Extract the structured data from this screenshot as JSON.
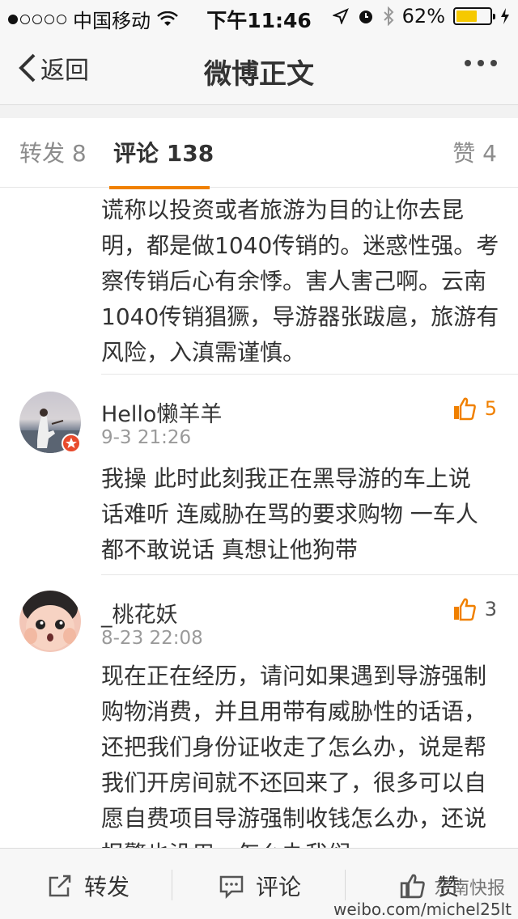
{
  "status_bar": {
    "carrier": "中国移动",
    "time": "下午11:46",
    "battery": "62%",
    "battery_level": 0.62
  },
  "nav": {
    "back_label": "返回",
    "title": "微博正文"
  },
  "tabs": {
    "repost": "转发 8",
    "comment": "评论 138",
    "like": "赞 4"
  },
  "comments": [
    {
      "text": "谎称以投资或者旅游为目的让你去昆明，都是做1040传销的。迷惑性强。考察传销后心有余悸。害人害己啊。云南1040传销猖獗，导游器张跋扈，旅游有风险，入滇需谨慎。"
    },
    {
      "name": "Hello懒羊羊",
      "time": "9-3 21:26",
      "likes": "5",
      "text": "我操 此时此刻我正在黑导游的车上说话难听 连威胁在骂的要求购物 一车人都不敢说话 真想让他狗带"
    },
    {
      "name": "_桃花妖",
      "time": "8-23 22:08",
      "likes": "3",
      "text": "现在正在经历，请问如果遇到导游强制购物消费，并且用带有威胁性的话语，还把我们身份证收走了怎么办，说是帮我们开房间就不还回来了，很多可以自愿自费项目导游强制收钱怎么办，还说报警也没用，怎么办我们"
    }
  ],
  "bottom_bar": {
    "repost": "转发",
    "comment": "评论",
    "like": "赞"
  },
  "watermark": {
    "badge": "东南快报",
    "url": "weibo.com/michel25lt"
  },
  "colors": {
    "accent": "#f08000",
    "text": "#333333",
    "muted": "#9a9a9a"
  }
}
